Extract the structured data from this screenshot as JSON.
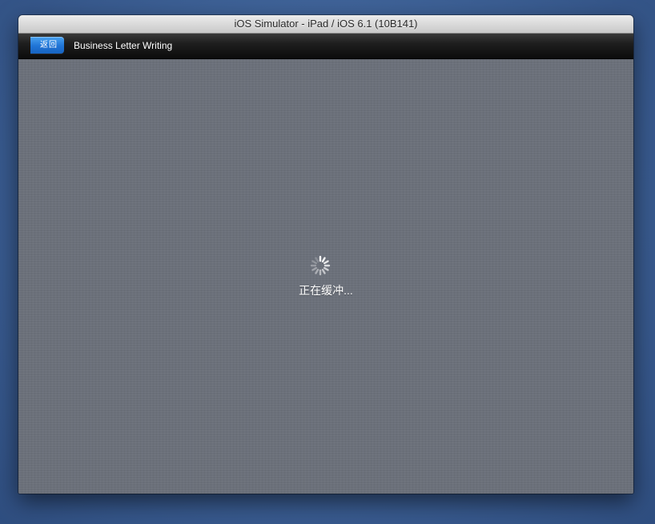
{
  "window": {
    "title": "iOS Simulator - iPad / iOS 6.1 (10B141)"
  },
  "navbar": {
    "back_label": "返回",
    "title": "Business Letter Writing"
  },
  "content": {
    "loading_text": "正在缓冲..."
  },
  "colors": {
    "back_button": "#1f74d6",
    "navbar": "#0c0c0c",
    "content_bg": "#6b707a"
  }
}
